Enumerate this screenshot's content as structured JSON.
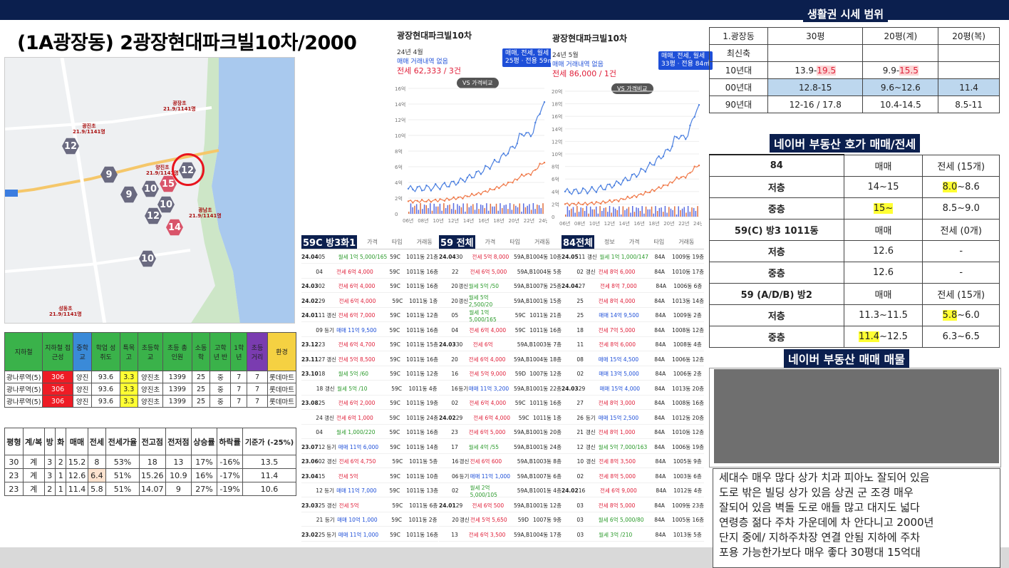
{
  "title": "(1A광장동) 2광장현대파크빌10차/2000",
  "map": {
    "hexes": [
      {
        "label": "12",
        "pink": false
      },
      {
        "label": "12",
        "pink": false
      },
      {
        "label": "9",
        "pink": false
      },
      {
        "label": "10",
        "pink": false
      },
      {
        "label": "9",
        "pink": false
      },
      {
        "label": "15",
        "pink": true
      },
      {
        "label": "10",
        "pink": false
      },
      {
        "label": "12",
        "pink": false
      },
      {
        "label": "14",
        "pink": true
      },
      {
        "label": "10",
        "pink": false
      }
    ]
  },
  "school_table": {
    "headers": [
      "지하철",
      "지하철 접근성",
      "중학교",
      "학업 성취도",
      "특목고",
      "초등학교",
      "초등 총인원",
      "소동 학",
      "고학년 반",
      "1학 년",
      "초등 거리",
      "환경"
    ],
    "header_colors": [
      "#3ab24a",
      "#3ab24a",
      "#3a8ad8",
      "#3ab24a",
      "#3ab24a",
      "#3ab24a",
      "#3ab24a",
      "#3ab24a",
      "#3ab24a",
      "#3ab24a",
      "#7a3cb0",
      "#f5d142"
    ],
    "rows": [
      [
        "광나루역(5)",
        "306",
        "양진",
        "93.6",
        "3.3",
        "양진초",
        "1399",
        "25",
        "중",
        "7",
        "7",
        "롯데마트"
      ],
      [
        "광나루역(5)",
        "306",
        "양진",
        "93.6",
        "3.3",
        "양진초",
        "1399",
        "25",
        "중",
        "7",
        "7",
        "롯데마트"
      ],
      [
        "광나루역(5)",
        "306",
        "양진",
        "93.6",
        "3.3",
        "양진초",
        "1399",
        "25",
        "중",
        "7",
        "7",
        "롯데마트"
      ]
    ]
  },
  "price_table": {
    "headers": [
      "평형",
      "계/복",
      "방",
      "화",
      "매매",
      "전세",
      "전세가율",
      "전고점",
      "전저점",
      "상승률",
      "하락률",
      "기준가 (-25%)"
    ],
    "rows": [
      [
        "30",
        "계",
        "3",
        "2",
        "15.2",
        "8",
        "53%",
        "18",
        "13",
        "17%",
        "-16%",
        "13.5"
      ],
      [
        "23",
        "계",
        "3",
        "1",
        "12.6",
        "6.4",
        "51%",
        "15.26",
        "10.9",
        "16%",
        "-17%",
        "11.4"
      ],
      [
        "23",
        "계",
        "2",
        "1",
        "11.4",
        "5.8",
        "51%",
        "14.07",
        "9",
        "27%",
        "-19%",
        "10.6"
      ]
    ]
  },
  "charts": [
    {
      "title": "광장현대파크빌10차",
      "date": "24년 4월",
      "line1": "매매 거래내역 없음",
      "line2": "전세 62,333 / 3건",
      "badge1": "매매, 전세, 월세",
      "badge2": "25평 · 전용 59㎡",
      "vs": "VS 가격비교",
      "y_ticks": [
        "16억",
        "14억",
        "12억",
        "10억",
        "8억",
        "6억",
        "4억",
        "2억",
        "0"
      ],
      "x_ticks": [
        "06년",
        "08년",
        "10년",
        "12년",
        "14년",
        "16년",
        "18년",
        "20년",
        "22년",
        "24년"
      ]
    },
    {
      "title": "광장현대파크빌10차",
      "date": "24년 5월",
      "line1": "매매 거래내역 없음",
      "line2": "전세 86,000 / 1건",
      "badge1": "매매, 전세, 월세",
      "badge2": "33평 · 전용 84㎡",
      "vs": "VS 가격비교",
      "y_ticks": [
        "20억",
        "18억",
        "16억",
        "14억",
        "12억",
        "10억",
        "8억",
        "6억",
        "4억",
        "2억",
        "0"
      ],
      "x_ticks": [
        "06년",
        "08년",
        "10년",
        "12년",
        "14년",
        "16년",
        "18년",
        "20년",
        "22년",
        "24년"
      ]
    }
  ],
  "trade_lists": [
    {
      "header": "59C 방3화1",
      "cols": [
        "가격",
        "타입",
        "거래동"
      ],
      "rows": [
        [
          "24.04",
          "05",
          "",
          "월세 1억 5,000/165",
          "59C",
          "1011동 21층"
        ],
        [
          "",
          "04",
          "",
          "전세 6억 4,000",
          "59C",
          "1011동 16층"
        ],
        [
          "24.03",
          "02",
          "",
          "전세 6억 4,000",
          "59C",
          "1011동 16층"
        ],
        [
          "24.02",
          "29",
          "",
          "전세 6억 4,000",
          "59C",
          "1011동 1층"
        ],
        [
          "24.01",
          "11",
          "갱신",
          "전세 6억 7,000",
          "59C",
          "1011동 12층"
        ],
        [
          "",
          "09",
          "등기",
          "매매 11억 9,500",
          "59C",
          "1011동 16층"
        ],
        [
          "23.12",
          "23",
          "",
          "전세 6억 4,700",
          "59C",
          "1011동 15층"
        ],
        [
          "23.11",
          "27",
          "갱신",
          "전세 5억 8,500",
          "59C",
          "1011동 16층"
        ],
        [
          "23.10",
          "18",
          "",
          "월세 5억 /60",
          "59C",
          "1011동 12층"
        ],
        [
          "",
          "18",
          "갱신",
          "월세 5억 /10",
          "59C",
          "1011동 4층"
        ],
        [
          "23.08",
          "25",
          "",
          "전세 6억 2,000",
          "59C",
          "1011동 19층"
        ],
        [
          "",
          "24",
          "갱신",
          "전세 6억 1,000",
          "59C",
          "1011동 24층"
        ],
        [
          "",
          "04",
          "",
          "월세 1,000/220",
          "59C",
          "1011동 16층"
        ],
        [
          "23.07",
          "12",
          "등기",
          "매매 11억 6,000",
          "59C",
          "1011동 14층"
        ],
        [
          "23.06",
          "02",
          "갱신",
          "전세 6억 4,750",
          "59C",
          "1011동 5층"
        ],
        [
          "23.04",
          "15",
          "",
          "전세 5억",
          "59C",
          "1011동 10층"
        ],
        [
          "",
          "12",
          "등기",
          "매매 11억 7,000",
          "59C",
          "1011동 13층"
        ],
        [
          "23.03",
          "25",
          "갱신",
          "전세 5억",
          "59C",
          "1011동 6층"
        ],
        [
          "",
          "21",
          "등기",
          "매매 10억 1,000",
          "59C",
          "1011동 2층"
        ],
        [
          "23.02",
          "25",
          "등기",
          "매매 11억 1,000",
          "59C",
          "1011동 16층"
        ],
        [
          "23.01",
          "14",
          "등기",
          "매매 10억 9,000",
          "59C",
          "1011동 11층"
        ]
      ]
    },
    {
      "header": "59 전체",
      "cols": [
        "가격",
        "타입",
        "거래동"
      ],
      "rows": [
        [
          "24.04",
          "30",
          "",
          "전세 5억 8,000",
          "59A,B",
          "1004동 10층"
        ],
        [
          "",
          "22",
          "",
          "전세 6억 5,000",
          "59A,B",
          "1004동 5층"
        ],
        [
          "",
          "20",
          "갱신",
          "월세 5억 /50",
          "59A,B",
          "1007동 25층"
        ],
        [
          "",
          "20",
          "갱신",
          "월세 5억 2,500/20",
          "59A,B",
          "1001동 15층"
        ],
        [
          "",
          "05",
          "",
          "월세 1억 5,000/165",
          "59C",
          "1011동 21층"
        ],
        [
          "",
          "04",
          "",
          "전세 6억 4,000",
          "59C",
          "1011동 16층"
        ],
        [
          "24.03",
          "30",
          "",
          "전세 6억",
          "59A,B",
          "1003동 7층"
        ],
        [
          "",
          "20",
          "",
          "전세 6억 4,000",
          "59A,B",
          "1004동 18층"
        ],
        [
          "",
          "16",
          "",
          "전세 5억 9,000",
          "59D",
          "1007동 12층"
        ],
        [
          "",
          "16",
          "등기",
          "매매 11억 3,200",
          "59A,B",
          "1001동 22층"
        ],
        [
          "",
          "02",
          "",
          "전세 6억 4,000",
          "59C",
          "1011동 16층"
        ],
        [
          "24.02",
          "29",
          "",
          "전세 6억 4,000",
          "59C",
          "1011동 1층"
        ],
        [
          "",
          "23",
          "",
          "전세 6억 5,000",
          "59A,B",
          "1001동 20층"
        ],
        [
          "",
          "17",
          "",
          "월세 4억 /55",
          "59A,B",
          "1001동 24층"
        ],
        [
          "",
          "16",
          "갱신",
          "전세 6억 600",
          "59A,B",
          "1003동 8층"
        ],
        [
          "",
          "06",
          "등기",
          "매매 11억 1,000",
          "59A,B",
          "1007동 6층"
        ],
        [
          "",
          "02",
          "",
          "월세 2억 5,000/105",
          "59A,B",
          "1001동 4층"
        ],
        [
          "24.01",
          "29",
          "",
          "전세 6억 500",
          "59A,B",
          "1001동 12층"
        ],
        [
          "",
          "20",
          "갱신",
          "전세 5억 5,650",
          "59D",
          "1007동 9층"
        ],
        [
          "",
          "13",
          "",
          "전세 6억 3,500",
          "59A,B",
          "1004동 17층"
        ]
      ]
    },
    {
      "header": "84전체",
      "cols": [
        "정보",
        "가격",
        "타입",
        "거래동"
      ],
      "rows": [
        [
          "24.05",
          "11",
          "갱신",
          "월세 1억 1,000/147",
          "84A",
          "1009동 19층"
        ],
        [
          "",
          "02",
          "갱신",
          "전세 8억 6,000",
          "84A",
          "1010동 17층"
        ],
        [
          "24.04",
          "27",
          "",
          "전세 8억 7,000",
          "84A",
          "1006동 6층"
        ],
        [
          "",
          "25",
          "",
          "전세 8억 4,000",
          "84A",
          "1013동 14층"
        ],
        [
          "",
          "25",
          "",
          "매매 14억 9,500",
          "84A",
          "1009동 2층"
        ],
        [
          "",
          "18",
          "",
          "전세 7억 5,000",
          "84A",
          "1008동 12층"
        ],
        [
          "",
          "11",
          "",
          "전세 8억 6,000",
          "84A",
          "1008동 4층"
        ],
        [
          "",
          "08",
          "",
          "매매 15억 4,500",
          "84A",
          "1006동 12층"
        ],
        [
          "",
          "02",
          "",
          "매매 13억 5,000",
          "84A",
          "1006동 2층"
        ],
        [
          "24.03",
          "29",
          "",
          "매매 15억 4,000",
          "84A",
          "1013동 20층"
        ],
        [
          "",
          "27",
          "",
          "전세 8억 3,000",
          "84A",
          "1008동 16층"
        ],
        [
          "",
          "26",
          "등기",
          "매매 15억 2,500",
          "84A",
          "1012동 20층"
        ],
        [
          "",
          "21",
          "갱신",
          "전세 8억 1,000",
          "84A",
          "1010동 12층"
        ],
        [
          "",
          "12",
          "갱신",
          "월세 5억 7,000/163",
          "84A",
          "1006동 19층"
        ],
        [
          "",
          "10",
          "갱신",
          "전세 8억 3,500",
          "84A",
          "1005동 9층"
        ],
        [
          "",
          "02",
          "",
          "전세 8억 5,000",
          "84A",
          "1003동 6층"
        ],
        [
          "24.02",
          "16",
          "",
          "전세 6억 9,000",
          "84A",
          "1012동 4층"
        ],
        [
          "",
          "03",
          "",
          "전세 8억 5,000",
          "84A",
          "1009동 23층"
        ],
        [
          "",
          "03",
          "",
          "월세 6억 5,000/80",
          "84A",
          "1005동 16층"
        ],
        [
          "",
          "03",
          "",
          "월세 3억 /210",
          "84A",
          "1013동 5층"
        ]
      ]
    }
  ],
  "living": {
    "title": "생활권 시세 범위",
    "headers": [
      "1.광장동",
      "30평",
      "20평(계)",
      "20평(복)"
    ],
    "rows": [
      [
        "최신축",
        "",
        "",
        ""
      ],
      [
        "10년대",
        "13.9-19.5",
        "9.9-15.5",
        ""
      ],
      [
        "00년대",
        "12.8-15",
        "9.6~12.6",
        "11.4"
      ],
      [
        "90년대",
        "12-16 / 17.8",
        "10.4-14.5",
        "8.5-11"
      ]
    ]
  },
  "naver_ask": {
    "title": "네이버 부동산 호가 매매/전세",
    "blocks": [
      {
        "h": [
          "84",
          "매매",
          "전세 (15개)"
        ],
        "rows": [
          [
            "저층",
            "14~15",
            "8.0~8.6"
          ],
          [
            "중층",
            "15~",
            "8.5~9.0"
          ]
        ]
      },
      {
        "h": [
          "59(C) 방3 1011동",
          "매매",
          "전세 (0개)"
        ],
        "rows": [
          [
            "저층",
            "12.6",
            "-"
          ],
          [
            "중층",
            "12.6",
            "-"
          ]
        ]
      },
      {
        "h": [
          "59 (A/D/B) 방2",
          "매매",
          "전세 (15개)"
        ],
        "rows": [
          [
            "저층",
            "11.3~11.5",
            "5.8~6.0"
          ],
          [
            "중층",
            "11.4~12.5",
            "6.3~6.5"
          ]
        ]
      }
    ]
  },
  "naver_listing": {
    "title": "네이버 부동산 매매 매물"
  },
  "note": [
    "세대수 매우 많다 상가 치과 피아노 잘되어 있음",
    "도로 밖은 빌딩 상가 있음 상권 군 조경 매우",
    "잘되어 있음 벽돌 도로 애들 많고 대지도 넓다",
    "연령층 젊다 주차 가운데에 차 안다니고 2000년",
    "단지 중에/ 지하주차장 연결 안됨 지하에 주차",
    "포용 가능한가보다 매우 좋다 30평대 15억대"
  ],
  "colors": {
    "navy": "#0b1f4e",
    "blue_line": "#4a7fe0",
    "orange_line": "#f07a4a",
    "highlight": "#ffff33",
    "red_cell": "#ee1c25"
  }
}
